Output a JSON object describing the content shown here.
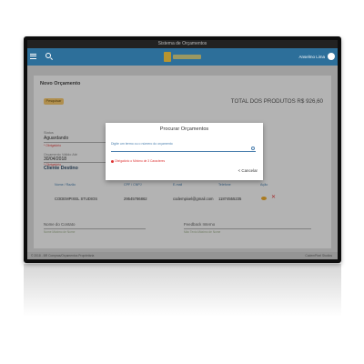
{
  "app": {
    "window_title": "Sistema de Orçamentos",
    "user_name": "Anselmo Lima"
  },
  "page": {
    "title": "Novo Orçamento",
    "status_pill": "Pesquisar",
    "total_label": "TOTAL DOS PRODUTOS R$ 926,60"
  },
  "form": {
    "status_label": "Status",
    "status_value": "Aguardando",
    "status_required": "* Obrigatório",
    "data_entrada_label": "Data de Entrada",
    "ultima_atualizacao_label": "Última Atualização",
    "orcamento_label": "Orçamento Válido Até",
    "orcamento_value": "30/04/2018",
    "orcamento_required": "* Obrigatório",
    "nome_contato_label": "Nome do Contato",
    "nome_contato_hint": "Nome Máximo de Nome",
    "feedback_label": "Feedback Interno",
    "feedback_hint": "Máx Texto Máximo de Nome"
  },
  "client_section": {
    "title": "Cliente Destino",
    "headers": [
      "Nome / Razão",
      "CPF / CNPJ",
      "E-mail",
      "Telefone",
      "Ação"
    ],
    "row": [
      "CODEMPIXEL STUDIOS",
      "29545786862",
      "codempixel@gmail.com",
      "11874555235"
    ]
  },
  "modal": {
    "title": "Procurar Orçamentos",
    "input_label": "Digite um termo ou o número do orçamento",
    "input_value": "",
    "error": "Obrigatório o Mínimo de 3 Caracteres",
    "cancel_label": "Cancelar"
  },
  "footer": {
    "left": "© 2018 - BR Compras/Orçamentos Proprietária",
    "right": "CodemPixel Studios"
  },
  "colors": {
    "topbar": "#2d6f9a",
    "accent": "#4a7fae",
    "error": "#dd3333",
    "pill": "#f0c060"
  }
}
